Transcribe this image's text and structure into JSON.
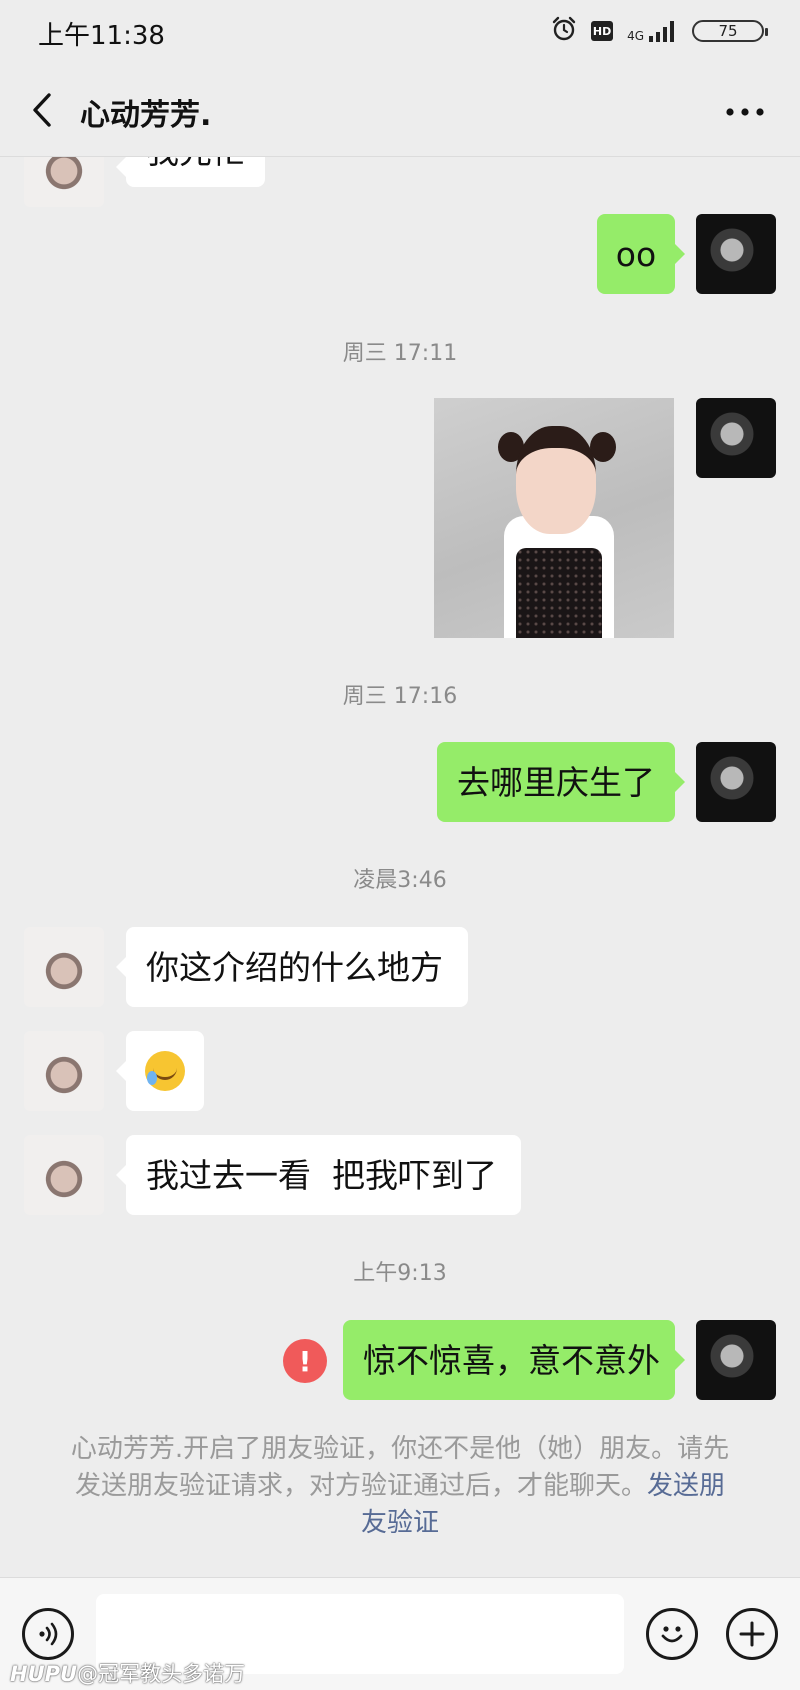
{
  "status_bar": {
    "time": "上午11:38",
    "network": "4G",
    "hd_label": "HD",
    "battery": "75"
  },
  "header": {
    "title": "心动芳芳."
  },
  "messages": {
    "partial_top_text": "我先忙",
    "oo_text": "oo",
    "ts1": "周三 17:11",
    "ts2": "周三 17:16",
    "out_where": "去哪里庆生了",
    "ts3": "凌晨3:46",
    "in1": "你这介绍的什么地方",
    "in3": "我过去一看  把我吓到了",
    "ts4": "上午9:13",
    "out_failed": "惊不惊喜，意不意外",
    "fail_mark": "!"
  },
  "system_notice": {
    "text": "心动芳芳.开启了朋友验证，你还不是他（她）朋友。请先发送朋友验证请求，对方验证通过后，才能聊天。",
    "link": "发送朋友验证"
  },
  "input": {
    "placeholder": ""
  },
  "watermark": {
    "brand": "HUPU",
    "handle": "@冠军教头多诺万"
  },
  "colors": {
    "background": "#ededed",
    "outgoing_bubble": "#95ec69",
    "incoming_bubble": "#ffffff",
    "link": "#576b95",
    "error": "#f05a5a"
  },
  "icons": {
    "back": "chevron-left-icon",
    "more": "more-dots-icon",
    "voice": "voice-icon",
    "emoji": "emoji-icon",
    "plus": "plus-icon",
    "alarm": "alarm-icon",
    "signal": "signal-icon",
    "battery": "battery-icon"
  }
}
